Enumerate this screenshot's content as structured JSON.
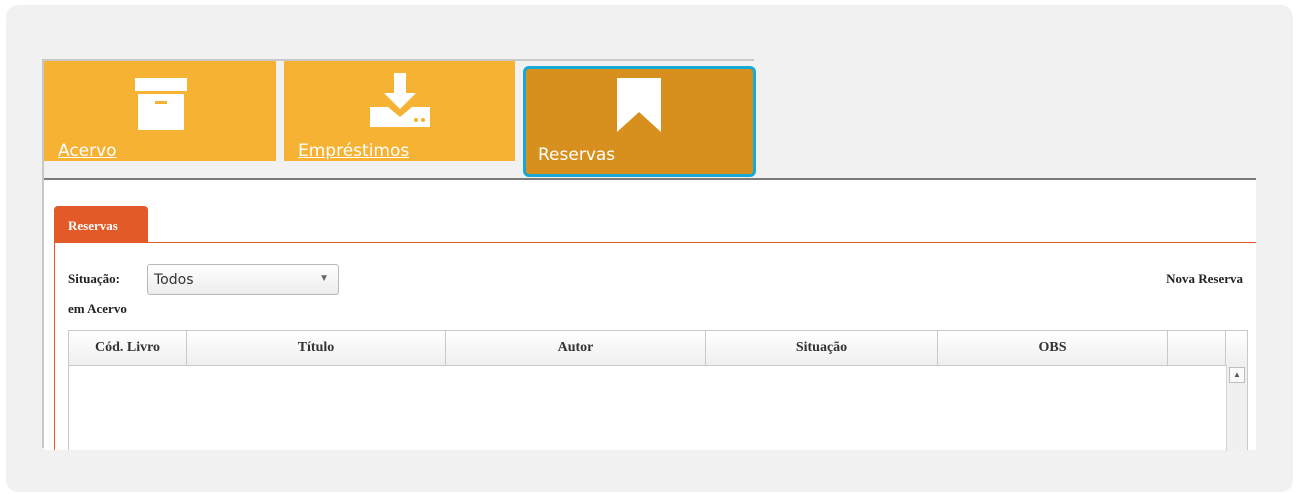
{
  "tiles": {
    "acervo": {
      "label": "Acervo",
      "icon": "archive-box-icon"
    },
    "emprestimos": {
      "label": "Empréstimos",
      "icon": "download-tray-icon"
    },
    "reservas": {
      "label": "Reservas",
      "icon": "bookmark-icon"
    }
  },
  "tab": {
    "label": "Reservas"
  },
  "filters": {
    "situacao_label": "Situação:",
    "situacao_value": "Todos",
    "em_acervo_label": "em Acervo"
  },
  "actions": {
    "nova_reserva": "Nova Reserva"
  },
  "table": {
    "columns": [
      "Cód. Livro",
      "Título",
      "Autor",
      "Situação",
      "OBS",
      ""
    ],
    "rows": []
  },
  "colors": {
    "tile": "#f6b233",
    "tile_active": "#d7901e",
    "active_border": "#17a8d6",
    "tab": "#e25a28"
  }
}
